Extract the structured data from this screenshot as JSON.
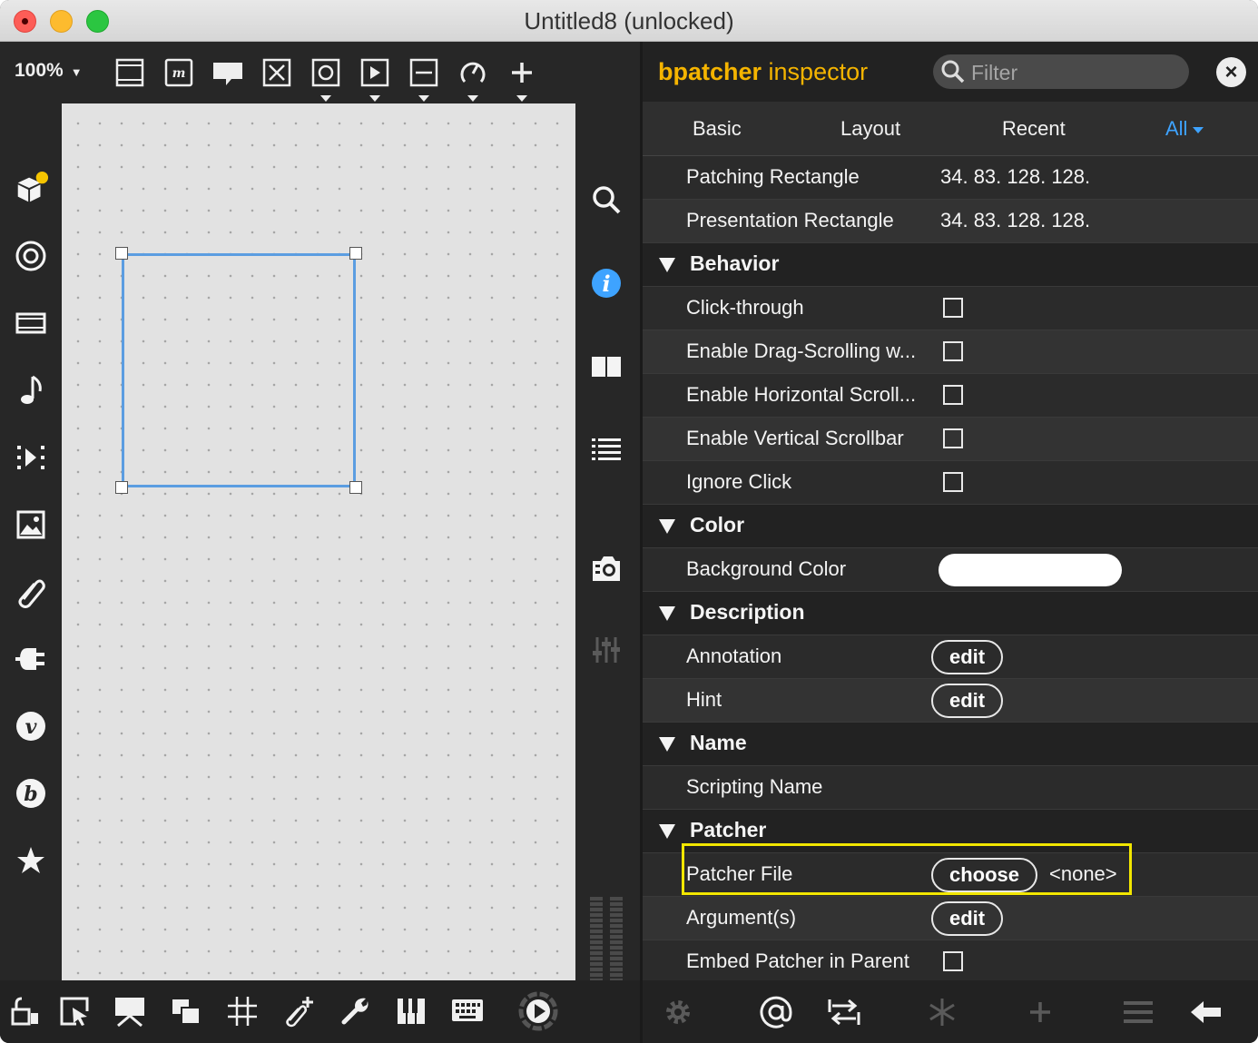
{
  "window": {
    "title": "Untitled8 (unlocked)"
  },
  "patcher_toolbar": {
    "zoom": "100%",
    "icons": [
      "presentation-icon",
      "message-icon",
      "comment-icon",
      "toggle-icon",
      "button-icon",
      "play-icon",
      "slider-icon",
      "dial-icon",
      "add-icon"
    ]
  },
  "left_strip": {
    "icons": [
      "packages-icon",
      "target-icon",
      "video-icon",
      "audio-note-icon",
      "sequence-icon",
      "image-icon",
      "clip-icon",
      "plugin-icon",
      "v-icon",
      "b-icon",
      "star-icon"
    ]
  },
  "right_strip": {
    "icons": [
      "search-icon",
      "info-icon",
      "columns-icon",
      "list-icon",
      "snapshot-icon",
      "mixer-icon"
    ]
  },
  "bottom_toolbar": {
    "icons": [
      "lock-icon",
      "select-icon",
      "presentation-icon",
      "layers-icon",
      "grid-icon",
      "add-clip-icon",
      "wrench-icon",
      "piano-icon",
      "keyboard-icon",
      "play-circle-icon"
    ]
  },
  "inspector": {
    "title_bold": "bpatcher",
    "title_rest": " inspector",
    "filter_placeholder": "Filter",
    "close": "×",
    "tabs": [
      "Basic",
      "Layout",
      "Recent",
      "All"
    ],
    "top_rows": [
      {
        "label": "Patching Rectangle",
        "value": "34. 83. 128. 128."
      },
      {
        "label": "Presentation Rectangle",
        "value": "34. 83. 128. 128."
      }
    ],
    "sections": {
      "behavior": {
        "title": "Behavior",
        "rows": [
          {
            "label": "Click-through",
            "checked": false
          },
          {
            "label": "Enable Drag-Scrolling w...",
            "checked": false
          },
          {
            "label": "Enable Horizontal Scroll...",
            "checked": false
          },
          {
            "label": "Enable Vertical Scrollbar",
            "checked": false
          },
          {
            "label": "Ignore Click",
            "checked": false
          }
        ]
      },
      "color": {
        "title": "Color",
        "rows": [
          {
            "label": "Background Color",
            "color": "#ffffff"
          }
        ]
      },
      "description": {
        "title": "Description",
        "rows": [
          {
            "label": "Annotation",
            "button": "edit"
          },
          {
            "label": "Hint",
            "button": "edit"
          }
        ]
      },
      "name": {
        "title": "Name",
        "rows": [
          {
            "label": "Scripting Name"
          }
        ]
      },
      "patcher": {
        "title": "Patcher",
        "rows": [
          {
            "label": "Patcher File",
            "button": "choose",
            "value": "<none>"
          },
          {
            "label": "Argument(s)",
            "button": "edit"
          },
          {
            "label": "Embed Patcher in Parent",
            "checked": false
          }
        ]
      }
    },
    "bottom_icons": [
      "gear-icon",
      "at-icon",
      "swap-icon",
      "snowflake-icon",
      "add-icon",
      "menu-icon",
      "back-arrow-icon"
    ]
  },
  "colors": {
    "accent_orange": "#f5b400",
    "accent_blue": "#3ea3ff",
    "selection_blue": "#5b9de1",
    "highlight_yellow": "#f2e600"
  }
}
